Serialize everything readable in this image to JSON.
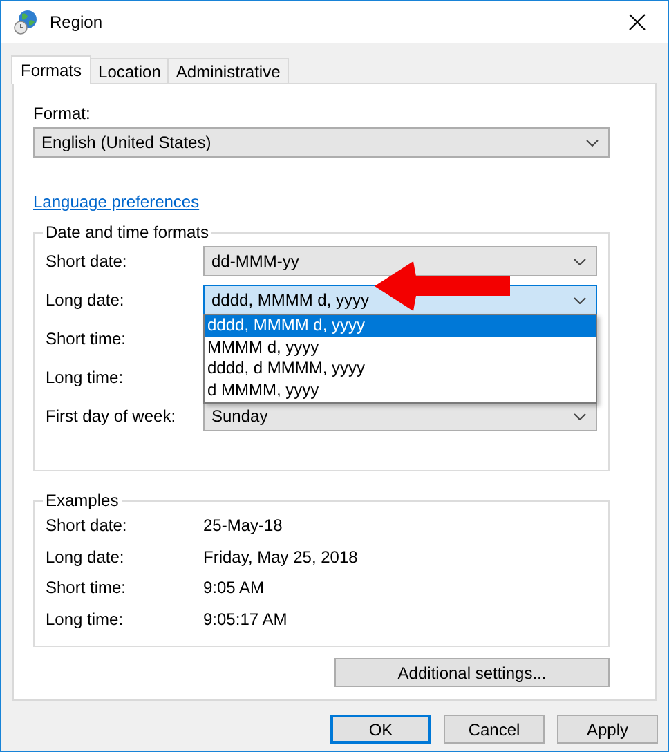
{
  "window": {
    "title": "Region"
  },
  "tabs": [
    {
      "label": "Formats",
      "selected": true
    },
    {
      "label": "Location",
      "selected": false
    },
    {
      "label": "Administrative",
      "selected": false
    }
  ],
  "format": {
    "label": "Format:",
    "value": "English (United States)"
  },
  "language_link": "Language preferences",
  "date_time_formats": {
    "title": "Date and time formats",
    "rows": [
      {
        "label": "Short date:",
        "value": "dd-MMM-yy",
        "focused": false
      },
      {
        "label": "Long date:",
        "value": "dddd, MMMM d, yyyy",
        "focused": true,
        "options": [
          {
            "label": "dddd, MMMM d, yyyy",
            "selected": true
          },
          {
            "label": "MMMM d, yyyy",
            "selected": false
          },
          {
            "label": "dddd, d MMMM, yyyy",
            "selected": false
          },
          {
            "label": "d MMMM, yyyy",
            "selected": false
          }
        ]
      },
      {
        "label": "Short time:"
      },
      {
        "label": "Long time:"
      },
      {
        "label": "First day of week:",
        "value": "Sunday",
        "focused": false
      }
    ]
  },
  "examples": {
    "title": "Examples",
    "rows": [
      {
        "label": "Short date:",
        "value": "25-May-18"
      },
      {
        "label": "Long date:",
        "value": "Friday, May 25, 2018"
      },
      {
        "label": "Short time:",
        "value": "9:05 AM"
      },
      {
        "label": "Long time:",
        "value": "9:05:17 AM"
      }
    ]
  },
  "additional_settings": "Additional settings...",
  "buttons": [
    {
      "label": "OK",
      "default": true
    },
    {
      "label": "Cancel",
      "default": false
    },
    {
      "label": "Apply",
      "default": false
    }
  ],
  "annotation": {
    "kind": "arrow"
  }
}
